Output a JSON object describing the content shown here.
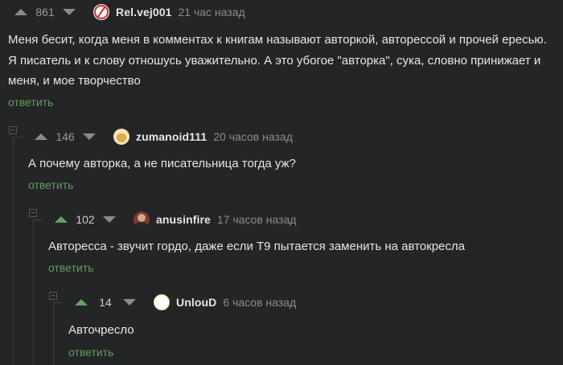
{
  "comments": [
    {
      "score": "861",
      "username": "Rel.vej001",
      "time": "21 час назад",
      "avatar_icon": "red-circle-slash-avatar",
      "text": "Меня бесит, когда меня в комментах к книгам называют авторкой, авторессой и прочей ересью. Я писатель и к слову отношусь уважительно. А это убогое \"авторка\", сука, словно принижает и меня, и мое творчество",
      "reply_label": "ответить"
    },
    {
      "score": "146",
      "username": "zumanoid111",
      "time": "20 часов назад",
      "avatar_icon": "cartoon-avatar",
      "text": "А почему авторка, а не писательница тогда уж?",
      "reply_label": "ответить"
    },
    {
      "score": "102",
      "username": "anusinfire",
      "time": "17 часов назад",
      "avatar_icon": "photo-avatar",
      "text": "Авторесса - звучит гордо, даже если Т9 пытается заменить на автокресла",
      "reply_label": "ответить"
    },
    {
      "score": "14",
      "username": "UnlouD",
      "time": "6 часов назад",
      "avatar_icon": "blank-avatar",
      "text": "Авточресло",
      "reply_label": "ответить"
    }
  ],
  "colors": {
    "background": "#242526",
    "upvote_active": "#63a35c",
    "reply_link": "#5f9f5a",
    "muted": "#8c8c8c"
  }
}
